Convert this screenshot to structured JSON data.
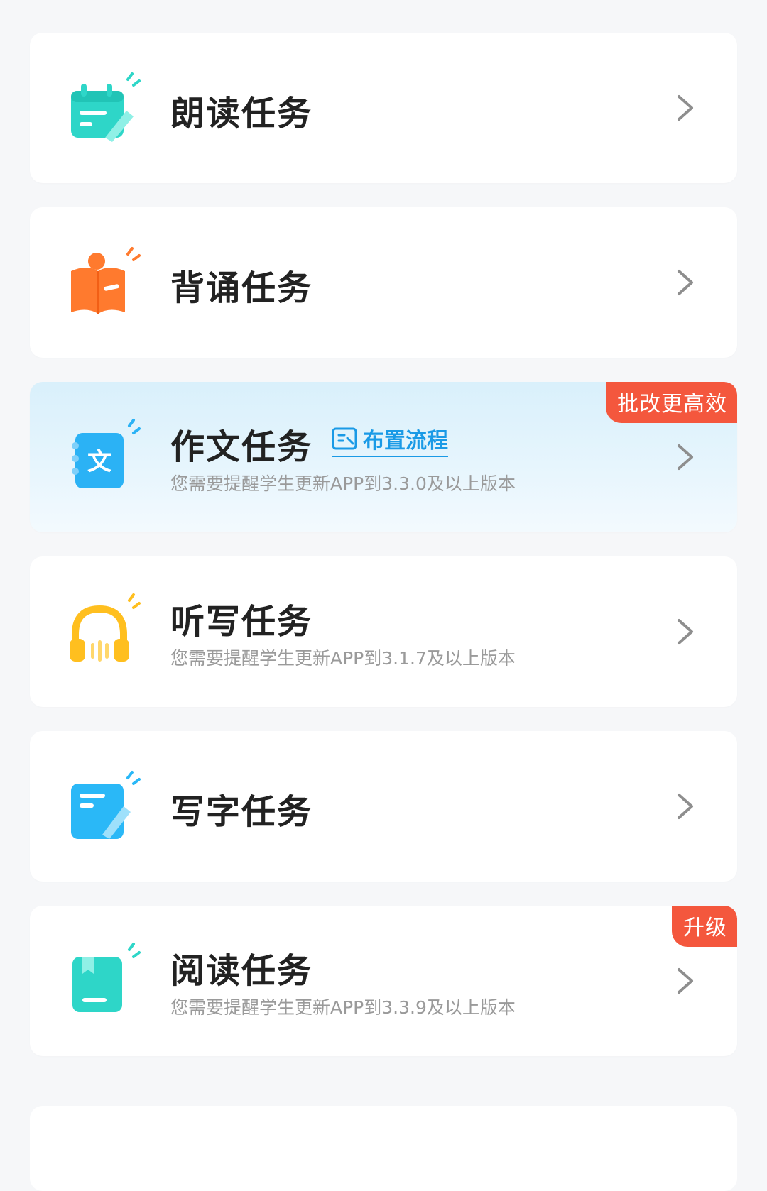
{
  "tasks": [
    {
      "title": "朗读任务",
      "subtitle": "",
      "badge": "",
      "icon": "calendar-pen-icon",
      "color": "#2ed6c8"
    },
    {
      "title": "背诵任务",
      "subtitle": "",
      "badge": "",
      "icon": "book-open-icon",
      "color": "#ff7a2e"
    },
    {
      "title": "作文任务",
      "subtitle": "您需要提醒学生更新APP到3.3.0及以上版本",
      "badge": "批改更高效",
      "flow_label": "布置流程",
      "icon": "essay-notebook-icon",
      "color": "#2bb2f5"
    },
    {
      "title": "听写任务",
      "subtitle": "您需要提醒学生更新APP到3.1.7及以上版本",
      "badge": "",
      "icon": "headphones-icon",
      "color": "#ffbf1f"
    },
    {
      "title": "写字任务",
      "subtitle": "",
      "badge": "",
      "icon": "note-pen-icon",
      "color": "#2ab8f7"
    },
    {
      "title": "阅读任务",
      "subtitle": "您需要提醒学生更新APP到3.3.9及以上版本",
      "badge": "升级",
      "icon": "bookmark-book-icon",
      "color": "#2ed6c8"
    }
  ],
  "colors": {
    "badge": "#f4573d",
    "link": "#1a9ae6",
    "highlight_bg": "#dff2fc"
  }
}
